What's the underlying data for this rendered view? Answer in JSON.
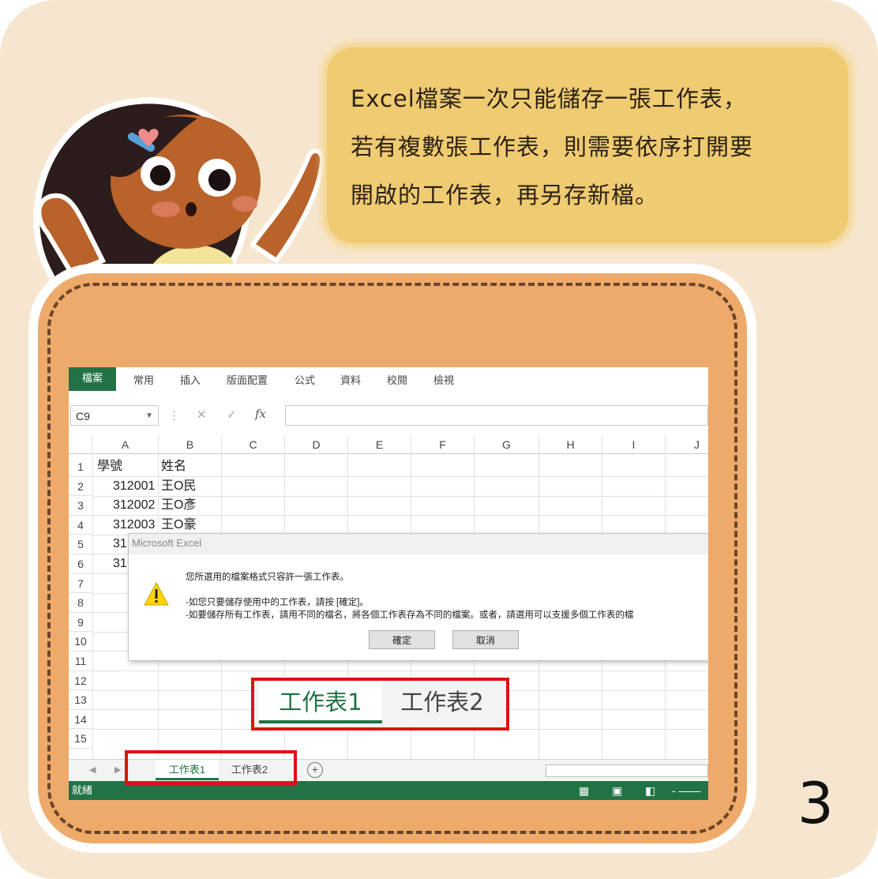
{
  "bubble": {
    "line1": "Excel檔案一次只能儲存一張工作表，",
    "line2": "若有複數張工作表，則需要依序打開要",
    "line3": "開啟的工作表，再另存新檔。"
  },
  "page_number": "3",
  "excel": {
    "ribbon_tabs": [
      "檔案",
      "常用",
      "插入",
      "版面配置",
      "公式",
      "資料",
      "校閱",
      "檢視"
    ],
    "name_box": "C9",
    "fx_label": "fx",
    "columns": [
      "A",
      "B",
      "C",
      "D",
      "E",
      "F",
      "G",
      "H",
      "I",
      "J"
    ],
    "rows": [
      "1",
      "2",
      "3",
      "4",
      "5",
      "6",
      "7",
      "8",
      "9",
      "10",
      "11",
      "12",
      "13",
      "14",
      "15"
    ],
    "cells": {
      "a1": "學號",
      "b1": "姓名",
      "a2": "312001",
      "b2": "王O民",
      "a3": "312002",
      "b3": "王O彥",
      "a4": "312003",
      "b4": "王O豪",
      "a5": "31",
      "a6": "31"
    },
    "sheet_tabs": [
      "工作表1",
      "工作表2"
    ],
    "status_text": "就緒",
    "zoom_tabs": [
      "工作表1",
      "工作表2"
    ]
  },
  "dialog": {
    "title": "Microsoft Excel",
    "message1": "您所選用的檔案格式只容許一張工作表。",
    "message2": "-如您只要儲存使用中的工作表，請按 [確定]。",
    "message3": "-如要儲存所有工作表，請用不同的檔名，將各個工作表存為不同的檔案。或者，請選用可以支援多個工作表的檔",
    "ok_label": "確定",
    "cancel_label": "取消"
  },
  "colors": {
    "excel_green": "#217346",
    "highlight_red": "#e01010",
    "bubble_yellow": "#efcb72",
    "panel_orange": "#eeaa6a",
    "background": "#f6e6cf"
  }
}
